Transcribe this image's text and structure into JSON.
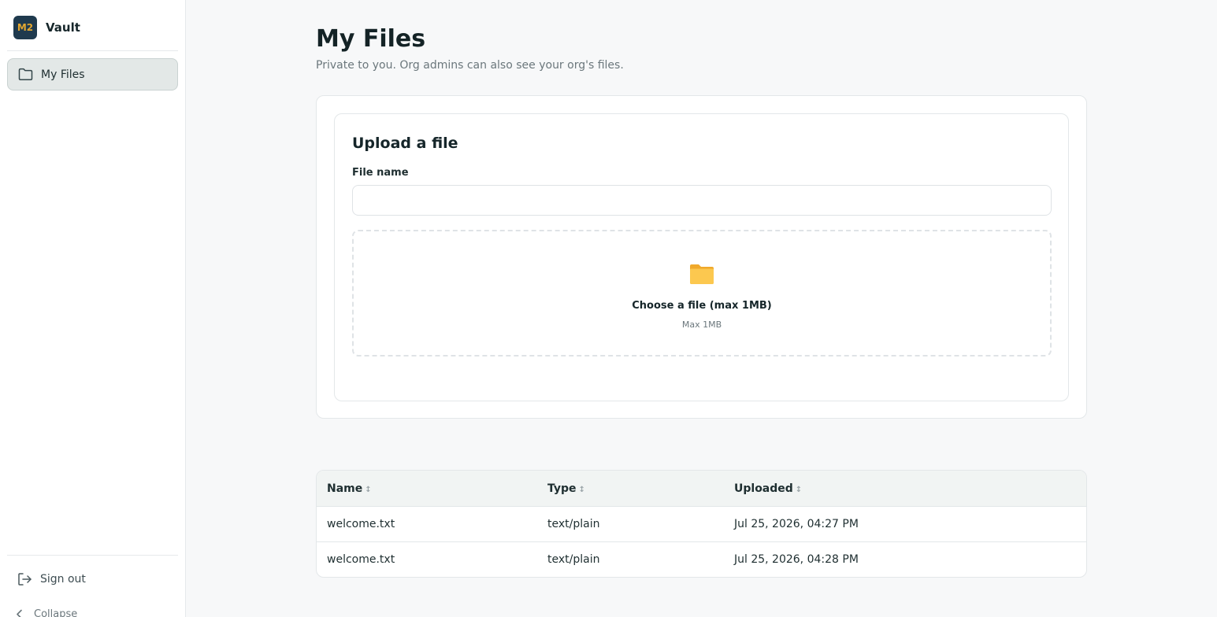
{
  "brand": {
    "logo_text": "M2",
    "name": "Vault"
  },
  "sidebar": {
    "items": [
      {
        "label": "My Files",
        "icon": "folder-icon",
        "active": true
      }
    ],
    "sign_out_label": "Sign out",
    "collapse_label": "Collapse"
  },
  "page": {
    "title": "My Files",
    "subtitle": "Private to you. Org admins can also see your org's files."
  },
  "upload": {
    "title": "Upload a file",
    "field_label": "File name",
    "field_value": "",
    "field_placeholder": "",
    "dropzone_label": "Choose a file (max 1MB)",
    "dropzone_hint": "Max 1MB"
  },
  "table": {
    "columns": [
      "Name",
      "Type",
      "Uploaded"
    ],
    "sort_glyph": "↕",
    "rows": [
      {
        "name": "welcome.txt",
        "type": "text/plain",
        "uploaded": "Jul 25, 2026, 04:27 PM"
      },
      {
        "name": "welcome.txt",
        "type": "text/plain",
        "uploaded": "Jul 25, 2026, 04:28 PM"
      }
    ]
  },
  "colors": {
    "brand_bg": "#1f3a4e",
    "brand_text": "#e3a730",
    "folder": "#f5b93b",
    "active_nav_bg": "#e3e8e7"
  }
}
